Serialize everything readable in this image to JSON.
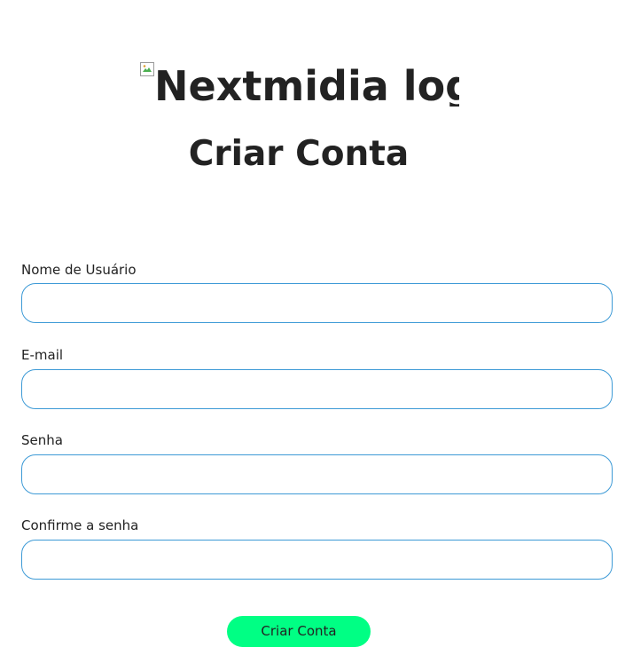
{
  "logo": {
    "alt_text": "Nextmidia logo",
    "icon": "broken-image-icon"
  },
  "page_title": "Criar Conta",
  "form": {
    "fields": [
      {
        "label": "Nome de Usuário",
        "value": "",
        "type": "text"
      },
      {
        "label": "E-mail",
        "value": "",
        "type": "email"
      },
      {
        "label": "Senha",
        "value": "",
        "type": "password"
      },
      {
        "label": "Confirme a senha",
        "value": "",
        "type": "password"
      }
    ],
    "submit_label": "Criar Conta"
  },
  "colors": {
    "input_border": "#3d9ad6",
    "button_bg": "#00ff84",
    "text": "#222222",
    "background": "#ffffff"
  }
}
